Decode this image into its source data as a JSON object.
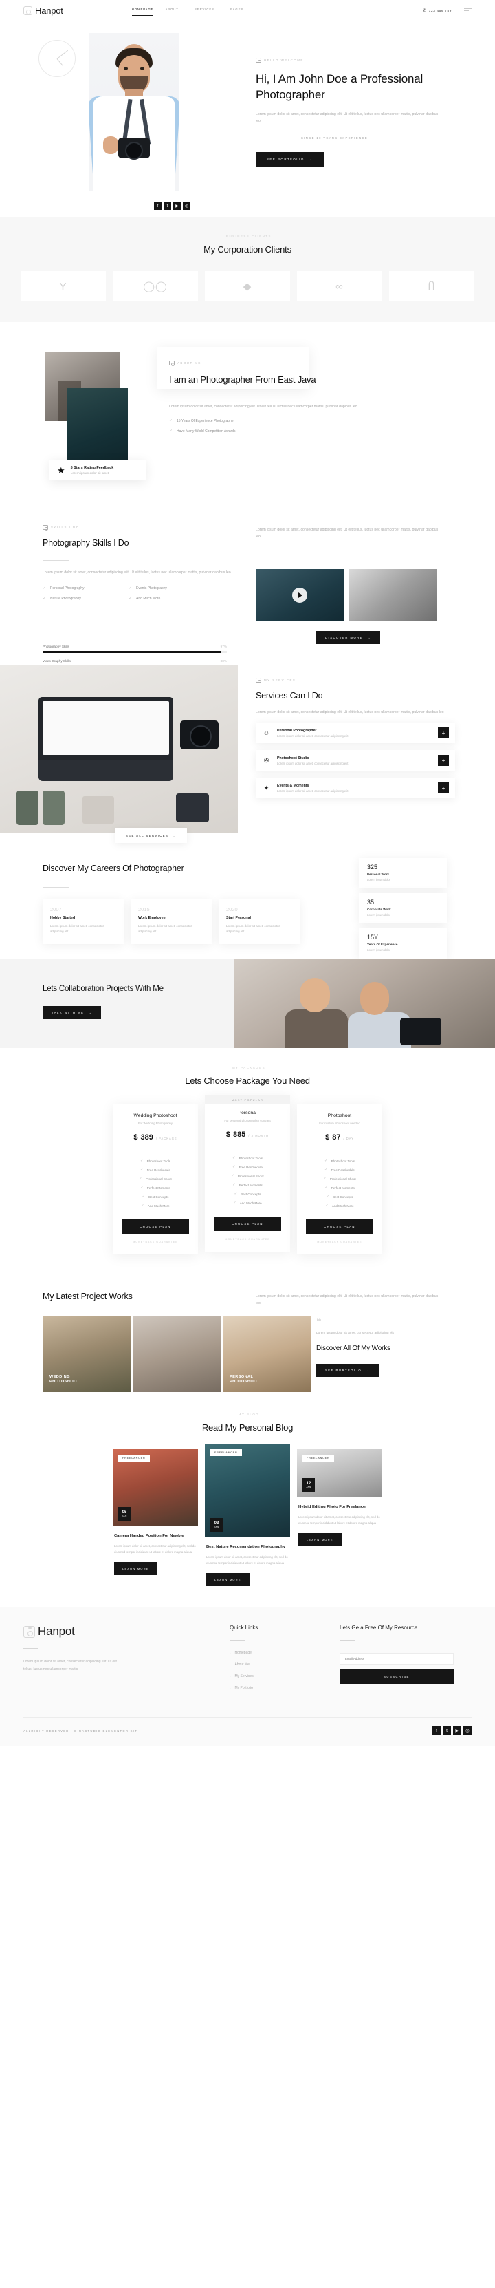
{
  "brand": {
    "name": "Hanpot",
    "icon": "camera-lock-logo"
  },
  "header": {
    "nav": [
      {
        "label": "HOMEPAGE",
        "caret": ""
      },
      {
        "label": "ABOUT",
        "caret": "⌄"
      },
      {
        "label": "SERVICES",
        "caret": "⌄"
      },
      {
        "label": "PAGES",
        "caret": "⌄"
      }
    ],
    "phone": "123 456 789",
    "phone_icon": "📞",
    "menu_icon": "hamburger-icon"
  },
  "hero": {
    "eyebrow": "HELLO WELCOME",
    "title": "Hi, I Am John Doe a Professional Photographer",
    "description": "Lorem ipsum dolor sit amet, consectetur adipiscing elit. Ut elit tellus, luctus nec ullamcorper mattis, pulvinar dapibus leo",
    "since": "SINCE 10 YEARS EXPERIENCE",
    "cta": "SEE PORTFOLIO",
    "cta_arrow": "→",
    "socials": [
      "f",
      "t",
      "▶",
      "◎"
    ]
  },
  "clients": {
    "eyebrow": "BUSINESS CLIENTS",
    "title": "My Corporation Clients",
    "logos": [
      "Y",
      "◯◯",
      "◆",
      "∞",
      "Ⴖ"
    ]
  },
  "about": {
    "eyebrow": "ABOUT ME",
    "title": "I am an Photographer From East Java",
    "description": "Lorem ipsum dolor sit amet, consectetur adipiscing elit. Ut elit tellus, luctus nec ullamcorper mattis, pulvinar dapibus leo",
    "points": [
      "15 Years Of Experience Photographer",
      "Have Many World Competition Awards"
    ],
    "badge": {
      "icon": "star-icon",
      "title": "5 Stars Rating Feedback",
      "subtitle": "Lorem ipsum dolor sit amet"
    }
  },
  "skills": {
    "eyebrow": "SKILLS I DO",
    "title": "Photography Skills I Do",
    "side_description": "Lorem ipsum dolor sit amet, consectetur adipiscing elit. Ut elit tellus, luctus nec ullamcorper mattis, pulvinar dapibus leo",
    "description": "Lorem ipsum dolor sit amet, consectetur adipiscing elit. Ut elit tellus, luctus nec ullamcorper mattis, pulvinar dapibus leo",
    "list": [
      "Personal Photography",
      "Events Photography",
      "Nature Photography",
      "And Much More"
    ],
    "bars": [
      {
        "label": "Photography Skills",
        "pct": "97%",
        "value": 97
      },
      {
        "label": "Video Graphy Skills",
        "pct": "88%",
        "value": 88
      }
    ],
    "cta": "DISCOVER MORE",
    "cta_arrow": "→",
    "play_icon": "play-icon"
  },
  "services": {
    "eyebrow": "MY SERVICES",
    "title": "Services Can I Do",
    "description": "Lorem ipsum dolor sit amet, consectetur adipiscing elit. Ut elit tellus, luctus nec ullamcorper mattis, pulvinar dapibus leo",
    "items": [
      {
        "icon": "👤",
        "title": "Personal Photographer",
        "subtitle": "Lorem ipsum dolor sit amet, consectetur adipiscing elit",
        "plus": "+"
      },
      {
        "icon": "🎬",
        "title": "Photoshoot Studio",
        "subtitle": "Lorem ipsum dolor sit amet, consectetur adipiscing elit",
        "plus": "+"
      },
      {
        "icon": "🎉",
        "title": "Events & Moments",
        "subtitle": "Lorem ipsum dolor sit amet, consectetur adipiscing elit",
        "plus": "+"
      }
    ],
    "cta": "SEE ALL SERVICES",
    "cta_arrow": "→"
  },
  "career": {
    "title": "Discover My Careers Of Photographer",
    "timeline": [
      {
        "year": "2007",
        "head": "Hobby Started",
        "body": "Lorem ipsum dolor sit amet, consectetur adipiscing elit"
      },
      {
        "year": "2015",
        "head": "Work Employee",
        "body": "Lorem ipsum dolor sit amet, consectetur adipiscing elit"
      },
      {
        "year": "2020",
        "head": "Start Personal",
        "body": "Lorem ipsum dolor sit amet, consectetur adipiscing elit"
      }
    ],
    "stats": [
      {
        "num": "325",
        "label": "Personal Work",
        "sub": "Lorem ipsum dolor"
      },
      {
        "num": "35",
        "label": "Corporate Work",
        "sub": "Lorem ipsum dolor"
      },
      {
        "num": "15Y",
        "label": "Years Of Experience",
        "sub": "Lorem ipsum dolor"
      }
    ]
  },
  "collab": {
    "title": "Lets Collaboration Projects With Me",
    "cta": "TALK WITH ME",
    "cta_arrow": "→"
  },
  "package": {
    "eyebrow": "MY PACKAGES",
    "title": "Lets Choose Package You Need",
    "popular_tag": "MOST POPULAR",
    "plans": [
      {
        "name": "Wedding Photoshoot",
        "for": "For Wedding Photography",
        "currency": "$",
        "amount": "389",
        "per": "/ PACKAGE",
        "features": [
          "Photoshoot Tools",
          "Free Reschedule",
          "Professional Shoot",
          "Perfect Moments",
          "Best Concepts",
          "And Much More"
        ],
        "button": "CHOOSE PLAN",
        "note": "MONEYBACK GUARANTEE",
        "featured": false
      },
      {
        "name": "Personal",
        "for": "For personal photographer contract",
        "currency": "$",
        "amount": "885",
        "per": "/ 3 MONTH",
        "features": [
          "Photoshoot Tools",
          "Free Reschedule",
          "Professional Shoot",
          "Perfect Moments",
          "Best Concepts",
          "And Much More"
        ],
        "button": "CHOOSE PLAN",
        "note": "MONEYBACK GUARANTEE",
        "featured": true
      },
      {
        "name": "Photoshoot",
        "for": "For custom photoshoot needed",
        "currency": "$",
        "amount": "87",
        "per": "/ DAY",
        "features": [
          "Photoshoot Tools",
          "Free Reschedule",
          "Professional Shoot",
          "Perfect Moments",
          "Best Concepts",
          "And Much More"
        ],
        "button": "CHOOSE PLAN",
        "note": "MONEYBACK GUARANTEE",
        "featured": false
      }
    ]
  },
  "portfolio": {
    "title": "My Latest Project Works",
    "description": "Lorem ipsum dolor sit amet, consectetur adipiscing elit. Ut elit tellus, luctus nec ullamcorper mattis, pulvinar dapibus leo",
    "items": [
      {
        "line1": "WEDDING",
        "line2": "PHOTOSHOOT"
      },
      {
        "line1": "",
        "line2": ""
      },
      {
        "line1": "PERSONAL",
        "line2": "PHOTOSHOOT"
      }
    ],
    "quote_mark": "❝",
    "quote": "Lorem ipsum dolor sit amet, consectetur adipiscing elit",
    "side_title": "Discover All Of My Works",
    "cta": "SEE PORTFOLIO",
    "cta_arrow": "→"
  },
  "blog": {
    "eyebrow": "MY BLOG",
    "title": "Read My Personal Blog",
    "posts": [
      {
        "tag": "Freelancer",
        "day": "05",
        "month": "JAN",
        "title": "Camera Handed Position For Newbie",
        "text": "Lorem ipsum dolor sit amet, consectetur adipiscing elit, sed do eiusmod tempor incididunt ut labore et dolore magna aliqua",
        "button": "LEARN MORE"
      },
      {
        "tag": "Freelancer",
        "day": "03",
        "month": "JAN",
        "title": "Best Nature Recomendation Photography",
        "text": "Lorem ipsum dolor sit amet, consectetur adipiscing elit, sed do eiusmod tempor incididunt ut labore et dolore magna aliqua",
        "button": "LEARN MORE"
      },
      {
        "tag": "Freelancer",
        "day": "12",
        "month": "JAN",
        "title": "Hybrid Editing Photo For Freelancer",
        "text": "Lorem ipsum dolor sit amet, consectetur adipiscing elit, sed do eiusmod tempor incididunt ut labore et dolore magna aliqua",
        "button": "LEARN MORE"
      }
    ]
  },
  "footer": {
    "description": "Lorem ipsum dolor sit amet, consectetur adipiscing elit. Ut elit tellus, luctus nec ullamcorper mattis",
    "quick_links_head": "Quick Links",
    "quick_links": [
      "Homepage",
      "About Me",
      "My Services",
      "My Portfolio"
    ],
    "newsletter_head": "Lets Ge a Free Of My Resource",
    "email_placeholder": "Email Address",
    "subscribe": "SUBSCRIBE",
    "copyright": "ALLRIGHT RESERVED - DIRASTUDIO ELEMENTOR KIT",
    "socials": [
      "f",
      "t",
      "▶",
      "◎"
    ]
  }
}
